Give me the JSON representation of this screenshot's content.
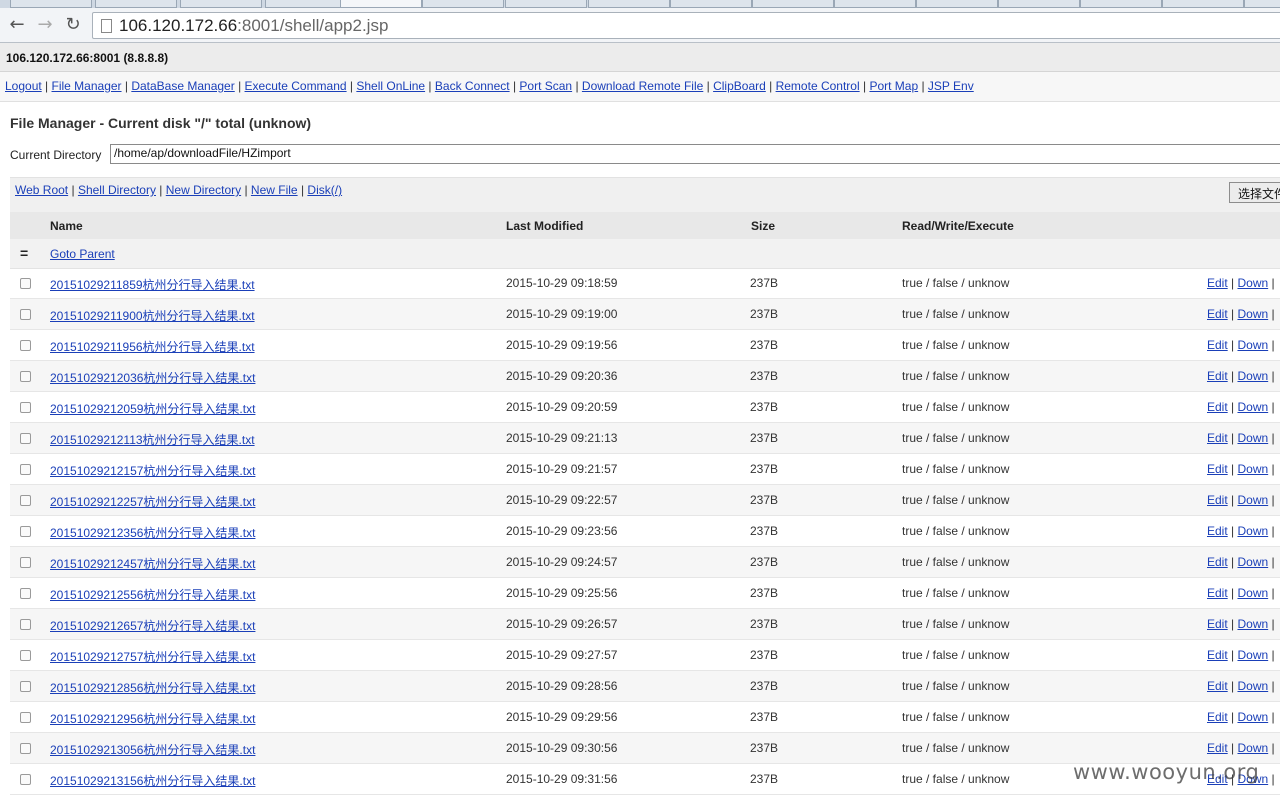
{
  "browser": {
    "url_host": "106.120.172.66",
    "url_port": ":8001",
    "url_path": "/shell/app2.jsp"
  },
  "host_info": "106.120.172.66:8001 (8.8.8.8)",
  "menu": [
    "Logout",
    "File Manager",
    "DataBase Manager",
    "Execute Command",
    "Shell OnLine",
    "Back Connect",
    "Port Scan",
    "Download Remote File",
    "ClipBoard",
    "Remote Control",
    "Port Map",
    "JSP Env"
  ],
  "page_title": "File Manager - Current disk \"/\" total (unknow)",
  "current_directory": {
    "label": "Current Directory",
    "value": "/home/ap/downloadFile/HZimport"
  },
  "links": [
    "Web Root",
    "Shell Directory",
    "New Directory",
    "New File",
    "Disk(/)"
  ],
  "choose_file_label": "选择文件",
  "table": {
    "headers": [
      "Name",
      "Last Modified",
      "Size",
      "Read/Write/Execute"
    ],
    "parent_label": "Goto Parent",
    "parent_icon": "=",
    "rows": [
      {
        "name": "20151029211859杭州分行导入结果.txt",
        "modified": "2015-10-29 09:18:59",
        "size": "237B",
        "rwx": "true / false / unknow"
      },
      {
        "name": "20151029211900杭州分行导入结果.txt",
        "modified": "2015-10-29 09:19:00",
        "size": "237B",
        "rwx": "true / false / unknow"
      },
      {
        "name": "20151029211956杭州分行导入结果.txt",
        "modified": "2015-10-29 09:19:56",
        "size": "237B",
        "rwx": "true / false / unknow"
      },
      {
        "name": "20151029212036杭州分行导入结果.txt",
        "modified": "2015-10-29 09:20:36",
        "size": "237B",
        "rwx": "true / false / unknow"
      },
      {
        "name": "20151029212059杭州分行导入结果.txt",
        "modified": "2015-10-29 09:20:59",
        "size": "237B",
        "rwx": "true / false / unknow"
      },
      {
        "name": "20151029212113杭州分行导入结果.txt",
        "modified": "2015-10-29 09:21:13",
        "size": "237B",
        "rwx": "true / false / unknow"
      },
      {
        "name": "20151029212157杭州分行导入结果.txt",
        "modified": "2015-10-29 09:21:57",
        "size": "237B",
        "rwx": "true / false / unknow"
      },
      {
        "name": "20151029212257杭州分行导入结果.txt",
        "modified": "2015-10-29 09:22:57",
        "size": "237B",
        "rwx": "true / false / unknow"
      },
      {
        "name": "20151029212356杭州分行导入结果.txt",
        "modified": "2015-10-29 09:23:56",
        "size": "237B",
        "rwx": "true / false / unknow"
      },
      {
        "name": "20151029212457杭州分行导入结果.txt",
        "modified": "2015-10-29 09:24:57",
        "size": "237B",
        "rwx": "true / false / unknow"
      },
      {
        "name": "20151029212556杭州分行导入结果.txt",
        "modified": "2015-10-29 09:25:56",
        "size": "237B",
        "rwx": "true / false / unknow"
      },
      {
        "name": "20151029212657杭州分行导入结果.txt",
        "modified": "2015-10-29 09:26:57",
        "size": "237B",
        "rwx": "true / false / unknow"
      },
      {
        "name": "20151029212757杭州分行导入结果.txt",
        "modified": "2015-10-29 09:27:57",
        "size": "237B",
        "rwx": "true / false / unknow"
      },
      {
        "name": "20151029212856杭州分行导入结果.txt",
        "modified": "2015-10-29 09:28:56",
        "size": "237B",
        "rwx": "true / false / unknow"
      },
      {
        "name": "20151029212956杭州分行导入结果.txt",
        "modified": "2015-10-29 09:29:56",
        "size": "237B",
        "rwx": "true / false / unknow"
      },
      {
        "name": "20151029213056杭州分行导入结果.txt",
        "modified": "2015-10-29 09:30:56",
        "size": "237B",
        "rwx": "true / false / unknow"
      },
      {
        "name": "20151029213156杭州分行导入结果.txt",
        "modified": "2015-10-29 09:31:56",
        "size": "237B",
        "rwx": "true / false / unknow"
      }
    ],
    "row_actions": [
      "Edit",
      "Down"
    ]
  },
  "watermark": "www.wooyun.org"
}
